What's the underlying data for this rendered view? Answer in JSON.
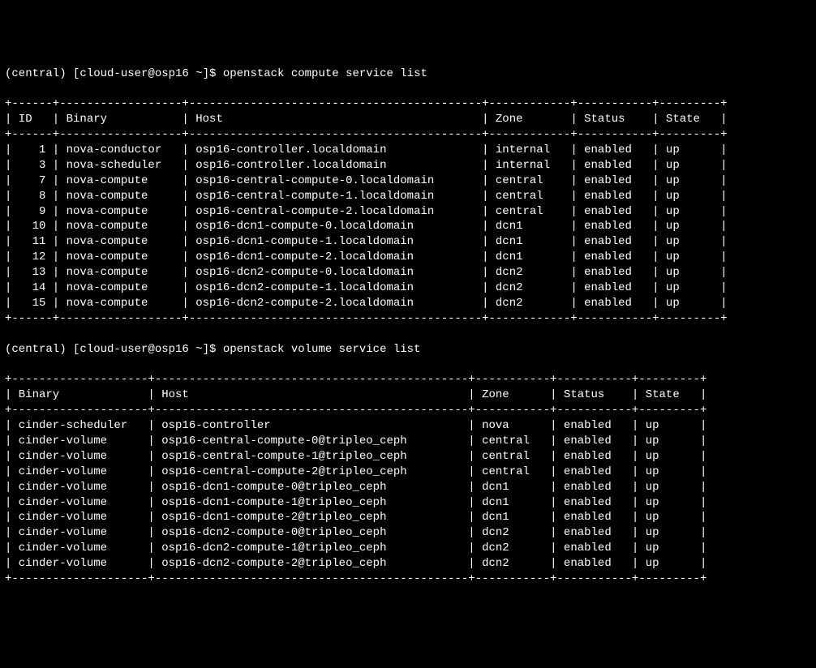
{
  "prompt_prefix": "(central) [cloud-user@osp16 ~]$ ",
  "command1": "openstack compute service list",
  "command2": "openstack volume service list",
  "table1": {
    "columns": [
      "ID",
      "Binary",
      "Host",
      "Zone",
      "Status",
      "State"
    ],
    "widths": [
      4,
      16,
      41,
      10,
      9,
      7
    ],
    "aligns": [
      "right",
      "left",
      "left",
      "left",
      "left",
      "left"
    ],
    "rows": [
      [
        "1",
        "nova-conductor",
        "osp16-controller.localdomain",
        "internal",
        "enabled",
        "up"
      ],
      [
        "3",
        "nova-scheduler",
        "osp16-controller.localdomain",
        "internal",
        "enabled",
        "up"
      ],
      [
        "7",
        "nova-compute",
        "osp16-central-compute-0.localdomain",
        "central",
        "enabled",
        "up"
      ],
      [
        "8",
        "nova-compute",
        "osp16-central-compute-1.localdomain",
        "central",
        "enabled",
        "up"
      ],
      [
        "9",
        "nova-compute",
        "osp16-central-compute-2.localdomain",
        "central",
        "enabled",
        "up"
      ],
      [
        "10",
        "nova-compute",
        "osp16-dcn1-compute-0.localdomain",
        "dcn1",
        "enabled",
        "up"
      ],
      [
        "11",
        "nova-compute",
        "osp16-dcn1-compute-1.localdomain",
        "dcn1",
        "enabled",
        "up"
      ],
      [
        "12",
        "nova-compute",
        "osp16-dcn1-compute-2.localdomain",
        "dcn1",
        "enabled",
        "up"
      ],
      [
        "13",
        "nova-compute",
        "osp16-dcn2-compute-0.localdomain",
        "dcn2",
        "enabled",
        "up"
      ],
      [
        "14",
        "nova-compute",
        "osp16-dcn2-compute-1.localdomain",
        "dcn2",
        "enabled",
        "up"
      ],
      [
        "15",
        "nova-compute",
        "osp16-dcn2-compute-2.localdomain",
        "dcn2",
        "enabled",
        "up"
      ]
    ]
  },
  "table2": {
    "columns": [
      "Binary",
      "Host",
      "Zone",
      "Status",
      "State"
    ],
    "widths": [
      18,
      44,
      9,
      9,
      7
    ],
    "aligns": [
      "left",
      "left",
      "left",
      "left",
      "left"
    ],
    "rows": [
      [
        "cinder-scheduler",
        "osp16-controller",
        "nova",
        "enabled",
        "up"
      ],
      [
        "cinder-volume",
        "osp16-central-compute-0@tripleo_ceph",
        "central",
        "enabled",
        "up"
      ],
      [
        "cinder-volume",
        "osp16-central-compute-1@tripleo_ceph",
        "central",
        "enabled",
        "up"
      ],
      [
        "cinder-volume",
        "osp16-central-compute-2@tripleo_ceph",
        "central",
        "enabled",
        "up"
      ],
      [
        "cinder-volume",
        "osp16-dcn1-compute-0@tripleo_ceph",
        "dcn1",
        "enabled",
        "up"
      ],
      [
        "cinder-volume",
        "osp16-dcn1-compute-1@tripleo_ceph",
        "dcn1",
        "enabled",
        "up"
      ],
      [
        "cinder-volume",
        "osp16-dcn1-compute-2@tripleo_ceph",
        "dcn1",
        "enabled",
        "up"
      ],
      [
        "cinder-volume",
        "osp16-dcn2-compute-0@tripleo_ceph",
        "dcn2",
        "enabled",
        "up"
      ],
      [
        "cinder-volume",
        "osp16-dcn2-compute-1@tripleo_ceph",
        "dcn2",
        "enabled",
        "up"
      ],
      [
        "cinder-volume",
        "osp16-dcn2-compute-2@tripleo_ceph",
        "dcn2",
        "enabled",
        "up"
      ]
    ]
  }
}
